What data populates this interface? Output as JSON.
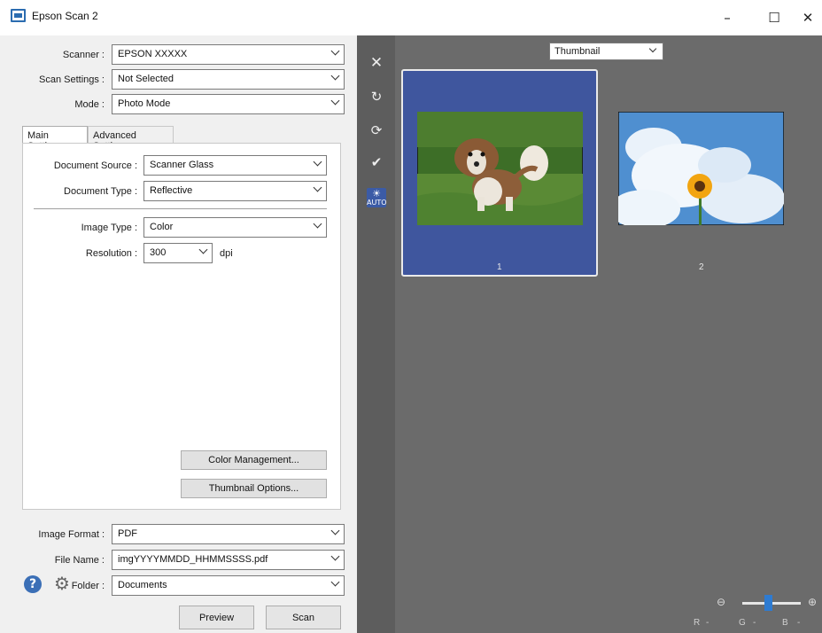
{
  "window": {
    "title": "Epson Scan 2",
    "minimize": "–",
    "maximize": "☐",
    "close": "✕"
  },
  "top_settings": {
    "scanner_label": "Scanner :",
    "scanner_value": "EPSON XXXXX",
    "scan_settings_label": "Scan Settings :",
    "scan_settings_value": "Not Selected",
    "mode_label": "Mode :",
    "mode_value": "Photo Mode"
  },
  "tabs": [
    {
      "label": "Main Settings",
      "active": true
    },
    {
      "label": "Advanced Settings",
      "active": false
    }
  ],
  "main_settings": {
    "document_source_label": "Document Source :",
    "document_source_value": "Scanner Glass",
    "document_type_label": "Document Type :",
    "document_type_value": "Reflective",
    "image_type_label": "Image Type :",
    "image_type_value": "Color",
    "resolution_label": "Resolution :",
    "resolution_value": "300",
    "resolution_unit": "dpi",
    "color_management_button": "Color Management...",
    "thumbnail_options_button": "Thumbnail Options..."
  },
  "output_settings": {
    "image_format_label": "Image Format :",
    "image_format_value": "PDF",
    "file_name_label": "File Name :",
    "file_name_value": "imgYYYYMMDD_HHMMSSSS.pdf",
    "folder_label": "Folder :",
    "folder_value": "Documents"
  },
  "bottom_bar": {
    "preview_button": "Preview",
    "scan_button": "Scan",
    "help_glyph": "?",
    "gear_glyph": "⚙"
  },
  "preview": {
    "view_mode": "Thumbnail",
    "thumbnails": [
      {
        "number": "1",
        "selected": true,
        "subject": "puppy on grass"
      },
      {
        "number": "2",
        "selected": false,
        "subject": "sunflower against cloudy sky"
      }
    ],
    "zoom_out_glyph": "⊖",
    "zoom_in_glyph": "⊕",
    "zoom_level": 0.45,
    "rgb_readout": {
      "r": "R",
      "g": "G",
      "b": "B",
      "r_val": "-",
      "g_val": "-",
      "b_val": "-"
    }
  },
  "toolbar": {
    "icons": [
      "close-preview-icon",
      "rotate-icon",
      "rotate-all-icon",
      "check-all-icon",
      "auto-exposure-icon"
    ],
    "auto_label": "AUTO",
    "close_glyph": "✕",
    "rotate_glyph": "↻",
    "rotate_all_glyph": "⟳",
    "check_glyph": "✔"
  },
  "colors": {
    "selected_card": "#3f569e",
    "preview_background": "#6b6b6b",
    "toolstrip_background": "#5d5d5d",
    "accent": "#2e7bd1"
  }
}
